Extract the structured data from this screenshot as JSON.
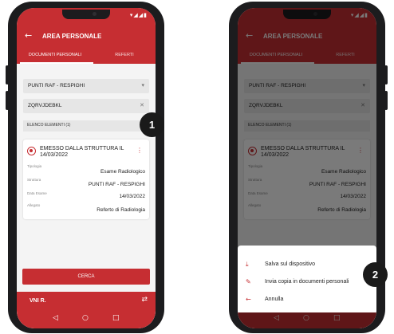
{
  "colors": {
    "accent": "#c62e32",
    "badge": "#1a1a1a",
    "field_bg": "#e6e6e6"
  },
  "status_icons": "▾◢◢▮",
  "header": {
    "back_icon": "arrow-left-icon",
    "title": "AREA PERSONALE"
  },
  "tabs": [
    {
      "label": "DOCUMENTI PERSONALI",
      "active": true
    },
    {
      "label": "REFERTI",
      "active": false
    }
  ],
  "filters": {
    "struttura": {
      "value": "PUNTI RAF - RESPIGHI",
      "icon": "chevron-down-icon"
    },
    "codice": {
      "value": "ZQRVJDEBKL",
      "icon": "clear-icon"
    }
  },
  "list_header": "ELENCO ELEMENTI (1)",
  "card": {
    "title": "EMESSO DALLA STRUTTURA IL 14/03/2022",
    "fields": [
      {
        "label": "Tipologia",
        "value": "Esame Radiologico"
      },
      {
        "label": "Struttura",
        "value": "PUNTI RAF - RESPIGHI"
      },
      {
        "label": "Data Esame",
        "value": "14/03/2022"
      },
      {
        "label": "Allegato",
        "value": "Referto di Radiologia"
      }
    ]
  },
  "search_button": "CERCA",
  "user_bar": {
    "name": "VNI R."
  },
  "nav": {
    "back": "◁",
    "home": "○",
    "recents": "□"
  },
  "sheet": {
    "items": [
      {
        "label": "Salva sul dispositivo",
        "icon": "download-icon"
      },
      {
        "label": "Invia copia in documenti personali",
        "icon": "edit-icon"
      },
      {
        "label": "Annulla",
        "icon": "arrow-left-icon"
      }
    ]
  },
  "badges": [
    "1",
    "2"
  ]
}
